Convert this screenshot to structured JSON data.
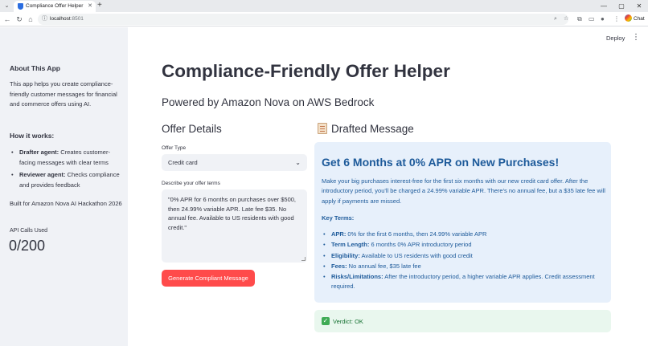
{
  "browser": {
    "tab_title": "Compliance Offer Helper",
    "url_host": "localhost",
    "url_port": ":8501",
    "chat_label": "Chat"
  },
  "header": {
    "deploy_label": "Deploy"
  },
  "sidebar": {
    "about_title": "About This App",
    "about_text": "This app helps you create compliance-friendly customer messages for financial and commerce offers using AI.",
    "how_title": "How it works:",
    "items": [
      {
        "bold": "Drafter agent:",
        "text": " Creates customer-facing messages with clear terms"
      },
      {
        "bold": "Reviewer agent:",
        "text": " Checks compliance and provides feedback"
      }
    ],
    "built_for": "Built for Amazon Nova AI Hackathon 2026",
    "metric_label": "API Calls Used",
    "metric_value": "0/200"
  },
  "main": {
    "title": "Compliance-Friendly Offer Helper",
    "subtitle": "Powered by Amazon Nova on AWS Bedrock",
    "offer_details_heading": "Offer Details",
    "offer_type_label": "Offer Type",
    "offer_type_value": "Credit card",
    "terms_label": "Describe your offer terms",
    "terms_value": "\"0% APR for 6 months on purchases over $500, then 24.99% variable APR. Late fee $35. No annual fee. Available to US residents with good credit.\"",
    "generate_button": "Generate Compliant Message",
    "drafted_heading": "Drafted Message",
    "message": {
      "title": "Get 6 Months at 0% APR on New Purchases!",
      "body": "Make your big purchases interest-free for the first six months with our new credit card offer. After the introductory period, you'll be charged a 24.99% variable APR. There's no annual fee, but a $35 late fee will apply if payments are missed.",
      "key_terms_label": "Key Terms:",
      "key_terms": [
        {
          "bold": "APR:",
          "text": " 0% for the first 6 months, then 24.99% variable APR"
        },
        {
          "bold": "Term Length:",
          "text": " 6 months 0% APR introductory period"
        },
        {
          "bold": "Eligibility:",
          "text": " Available to US residents with good credit"
        },
        {
          "bold": "Fees:",
          "text": " No annual fee, $35 late fee"
        },
        {
          "bold": "Risks/Limitations:",
          "text": " After the introductory period, a higher variable APR applies. Credit assessment required."
        }
      ]
    },
    "verdict": "Verdict: OK"
  }
}
